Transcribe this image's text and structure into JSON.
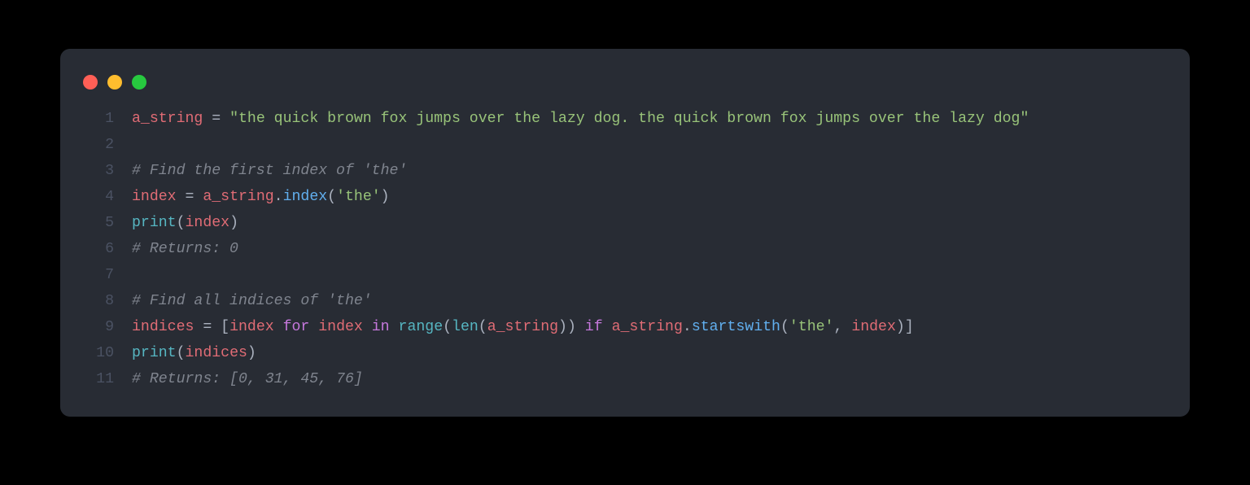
{
  "window": {
    "traffic_lights": [
      "red",
      "yellow",
      "green"
    ]
  },
  "code": {
    "lines": [
      {
        "n": "1",
        "tokens": [
          {
            "t": "a_string",
            "c": "var"
          },
          {
            "t": " ",
            "c": "default"
          },
          {
            "t": "=",
            "c": "op"
          },
          {
            "t": " ",
            "c": "default"
          },
          {
            "t": "\"the quick brown fox jumps over the lazy dog. the quick brown fox jumps over the lazy dog\"",
            "c": "str"
          }
        ]
      },
      {
        "n": "2",
        "tokens": []
      },
      {
        "n": "3",
        "tokens": [
          {
            "t": "# Find the first index of 'the'",
            "c": "com"
          }
        ]
      },
      {
        "n": "4",
        "tokens": [
          {
            "t": "index",
            "c": "var"
          },
          {
            "t": " ",
            "c": "default"
          },
          {
            "t": "=",
            "c": "op"
          },
          {
            "t": " ",
            "c": "default"
          },
          {
            "t": "a_string",
            "c": "var"
          },
          {
            "t": ".",
            "c": "punc"
          },
          {
            "t": "index",
            "c": "func"
          },
          {
            "t": "(",
            "c": "punc"
          },
          {
            "t": "'the'",
            "c": "str"
          },
          {
            "t": ")",
            "c": "punc"
          }
        ]
      },
      {
        "n": "5",
        "tokens": [
          {
            "t": "print",
            "c": "builtin"
          },
          {
            "t": "(",
            "c": "punc"
          },
          {
            "t": "index",
            "c": "var"
          },
          {
            "t": ")",
            "c": "punc"
          }
        ]
      },
      {
        "n": "6",
        "tokens": [
          {
            "t": "# Returns: 0",
            "c": "com"
          }
        ]
      },
      {
        "n": "7",
        "tokens": []
      },
      {
        "n": "8",
        "tokens": [
          {
            "t": "# Find all indices of 'the'",
            "c": "com"
          }
        ]
      },
      {
        "n": "9",
        "tokens": [
          {
            "t": "indices",
            "c": "var"
          },
          {
            "t": " ",
            "c": "default"
          },
          {
            "t": "=",
            "c": "op"
          },
          {
            "t": " ",
            "c": "default"
          },
          {
            "t": "[",
            "c": "punc"
          },
          {
            "t": "index",
            "c": "var"
          },
          {
            "t": " ",
            "c": "default"
          },
          {
            "t": "for",
            "c": "kw"
          },
          {
            "t": " ",
            "c": "default"
          },
          {
            "t": "index",
            "c": "var"
          },
          {
            "t": " ",
            "c": "default"
          },
          {
            "t": "in",
            "c": "kw"
          },
          {
            "t": " ",
            "c": "default"
          },
          {
            "t": "range",
            "c": "builtin"
          },
          {
            "t": "(",
            "c": "punc"
          },
          {
            "t": "len",
            "c": "builtin"
          },
          {
            "t": "(",
            "c": "punc"
          },
          {
            "t": "a_string",
            "c": "var"
          },
          {
            "t": ")",
            "c": "punc"
          },
          {
            "t": ")",
            "c": "punc"
          },
          {
            "t": " ",
            "c": "default"
          },
          {
            "t": "if",
            "c": "kw"
          },
          {
            "t": " ",
            "c": "default"
          },
          {
            "t": "a_string",
            "c": "var"
          },
          {
            "t": ".",
            "c": "punc"
          },
          {
            "t": "startswith",
            "c": "func"
          },
          {
            "t": "(",
            "c": "punc"
          },
          {
            "t": "'the'",
            "c": "str"
          },
          {
            "t": ",",
            "c": "punc"
          },
          {
            "t": " ",
            "c": "default"
          },
          {
            "t": "index",
            "c": "var"
          },
          {
            "t": ")",
            "c": "punc"
          },
          {
            "t": "]",
            "c": "punc"
          }
        ]
      },
      {
        "n": "10",
        "tokens": [
          {
            "t": "print",
            "c": "builtin"
          },
          {
            "t": "(",
            "c": "punc"
          },
          {
            "t": "indices",
            "c": "var"
          },
          {
            "t": ")",
            "c": "punc"
          }
        ]
      },
      {
        "n": "11",
        "tokens": [
          {
            "t": "# Returns: [0, 31, 45, 76]",
            "c": "com"
          }
        ]
      }
    ]
  }
}
